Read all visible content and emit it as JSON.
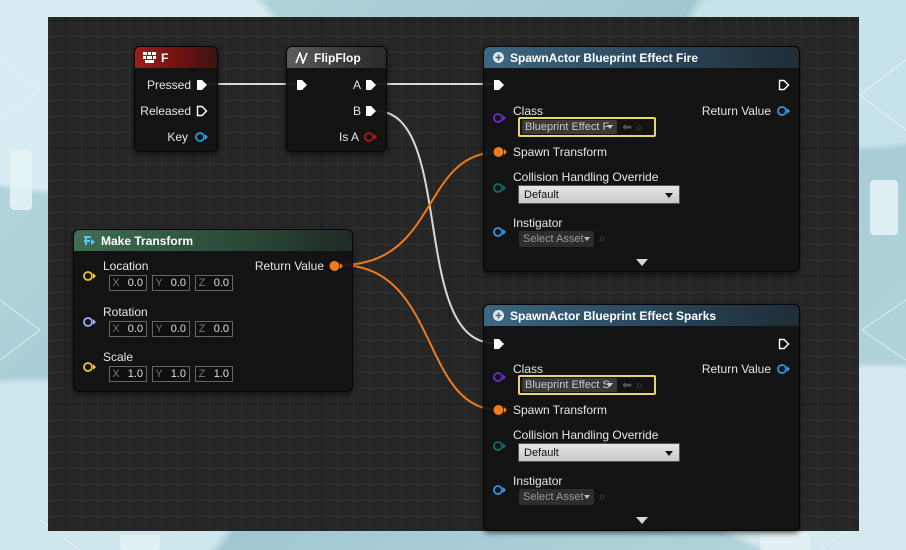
{
  "nodes": {
    "key_f": {
      "title": "F",
      "pins": {
        "pressed": "Pressed",
        "released": "Released",
        "key": "Key"
      }
    },
    "flipflop": {
      "title": "FlipFlop",
      "pins": {
        "a": "A",
        "b": "B",
        "is_a": "Is A"
      }
    },
    "make_transform": {
      "title": "Make Transform",
      "return_value": "Return Value",
      "location": {
        "label": "Location",
        "x": "0.0",
        "y": "0.0",
        "z": "0.0"
      },
      "rotation": {
        "label": "Rotation",
        "x": "0.0",
        "y": "0.0",
        "z": "0.0"
      },
      "scale": {
        "label": "Scale",
        "x": "1.0",
        "y": "1.0",
        "z": "1.0"
      },
      "axis": {
        "x": "X",
        "y": "Y",
        "z": "Z"
      }
    },
    "spawn_fire": {
      "title": "SpawnActor Blueprint Effect Fire",
      "class_label": "Class",
      "class_value": "Blueprint Effect F",
      "return_value": "Return Value",
      "spawn_transform": "Spawn Transform",
      "collision_label": "Collision Handling Override",
      "collision_value": "Default",
      "instigator_label": "Instigator",
      "instigator_value": "Select Asset"
    },
    "spawn_sparks": {
      "title": "SpawnActor Blueprint Effect Sparks",
      "class_label": "Class",
      "class_value": "Blueprint Effect S",
      "return_value": "Return Value",
      "spawn_transform": "Spawn Transform",
      "collision_label": "Collision Handling Override",
      "collision_value": "Default",
      "instigator_label": "Instigator",
      "instigator_value": "Select Asset"
    }
  },
  "colors": {
    "exec": "#ffffff",
    "transform_pin": "#f07b1c",
    "class_pin": "#6a2ec2",
    "object_pin": "#2c9be8",
    "enum_pin": "#0b6f68",
    "vector_pin": "#f0c62e",
    "rotator_pin": "#9fb1ff",
    "bool_pin": "#b01818",
    "asset_highlight": "#e9d56b",
    "background": "#262626"
  }
}
